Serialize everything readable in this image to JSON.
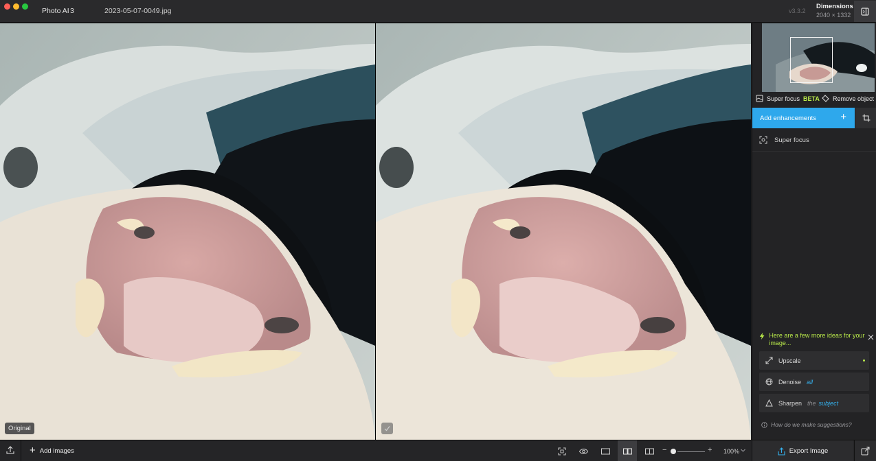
{
  "titlebar": {
    "app_name": "Photo AI",
    "app_version": "3",
    "file_name": "2023-05-07-0049.jpg",
    "build_version": "v3.3.2",
    "dimensions_label": "Dimensions",
    "dimensions_value": "2040 × 1332"
  },
  "canvas": {
    "original_badge": "Original"
  },
  "panel": {
    "tools": {
      "super_focus_label": "Super focus",
      "super_focus_badge": "BETA",
      "remove_object_label": "Remove object"
    },
    "add_enhancements_label": "Add enhancements",
    "enhancements": [
      {
        "label": "Super focus",
        "icon": "focus-frame-icon"
      }
    ],
    "ideas": {
      "heading": "Here are a few more ideas for your image...",
      "items": [
        {
          "label": "Upscale",
          "icon": "expand-arrows-icon"
        },
        {
          "label": "Denoise",
          "accent": "all",
          "icon": "globe-icon"
        },
        {
          "label": "Sharpen",
          "muted": "the",
          "accent": "subject",
          "icon": "triangle-icon"
        }
      ],
      "help_link": "How do we make suggestions?"
    }
  },
  "bottombar": {
    "add_images_label": "Add images",
    "zoom_value": "100%",
    "export_label": "Export Image"
  },
  "colors": {
    "accent_blue": "#2ea8ec",
    "accent_green": "#b9e94a",
    "background": "#1c1c1e",
    "panel": "#232325"
  }
}
